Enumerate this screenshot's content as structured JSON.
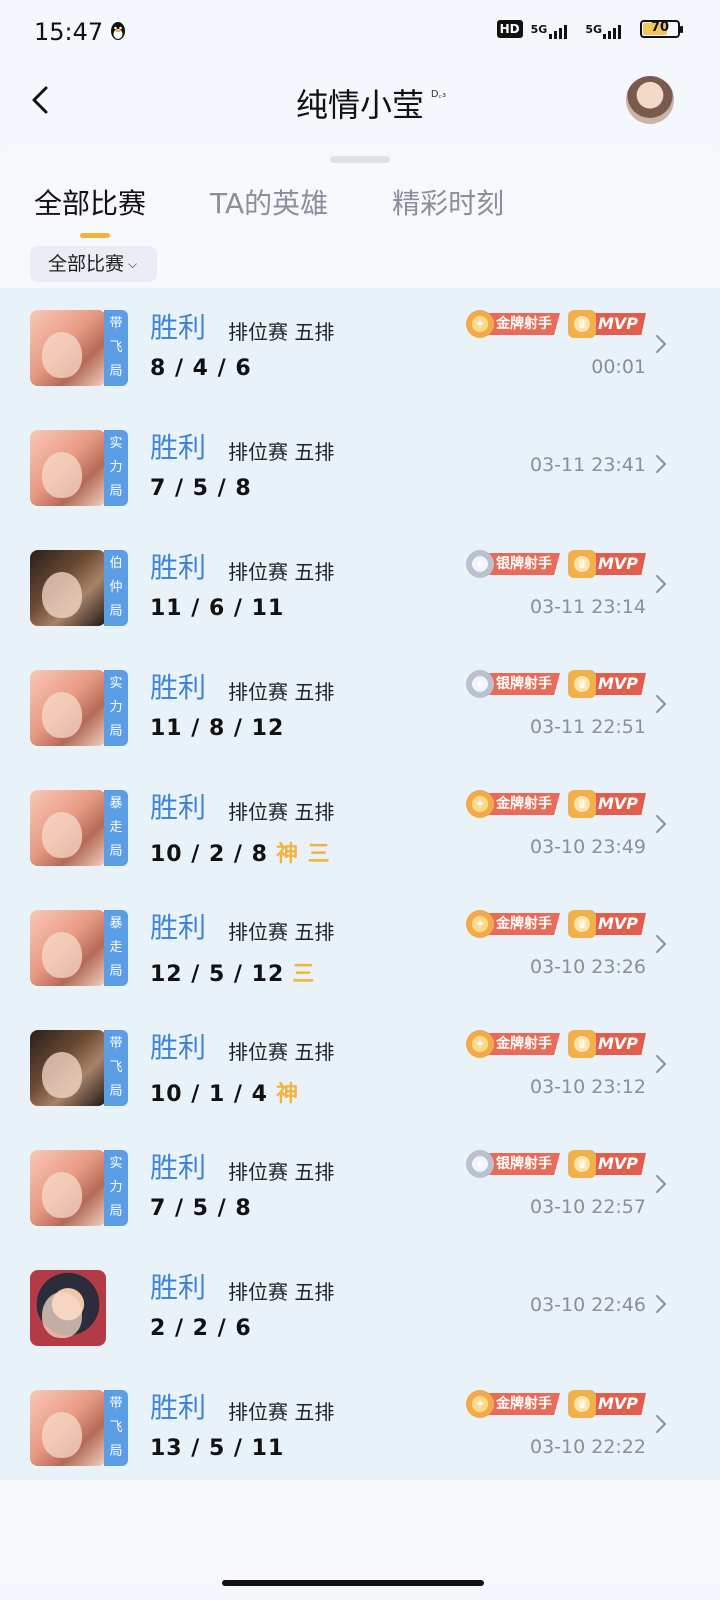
{
  "status_bar": {
    "time": "15:47",
    "hd_label": "HD",
    "net1": "5G",
    "net2": "5G",
    "battery": "70",
    "battery_level": 0.7
  },
  "header": {
    "title": "纯情小莹",
    "title_badge": "D꜀₃"
  },
  "tabs": [
    {
      "label": "全部比赛",
      "active": true
    },
    {
      "label": "TA的英雄",
      "active": false
    },
    {
      "label": "精彩时刻",
      "active": false
    }
  ],
  "filter": {
    "label": "全部比赛"
  },
  "badge_labels": {
    "gold": "金牌射手",
    "silver": "银牌射手",
    "mvp": "MVP"
  },
  "matches": [
    {
      "hero_style": "pink",
      "tag": "带飞局",
      "result": "胜利",
      "mode": "排位赛 五排",
      "kda": "8 / 4 / 6",
      "extra": "",
      "time": "00:01",
      "badge": "gold",
      "mvp": true
    },
    {
      "hero_style": "pink",
      "tag": "实力局",
      "result": "胜利",
      "mode": "排位赛 五排",
      "kda": "7 / 5 / 8",
      "extra": "",
      "time": "03-11 23:41",
      "badge": "",
      "mvp": false
    },
    {
      "hero_style": "dark",
      "tag": "伯仲局",
      "result": "胜利",
      "mode": "排位赛 五排",
      "kda": "11 / 6 / 11",
      "extra": "",
      "time": "03-11 23:14",
      "badge": "silver",
      "mvp": true
    },
    {
      "hero_style": "pink",
      "tag": "实力局",
      "result": "胜利",
      "mode": "排位赛 五排",
      "kda": "11 / 8 / 12",
      "extra": "",
      "time": "03-11 22:51",
      "badge": "silver",
      "mvp": true
    },
    {
      "hero_style": "pink",
      "tag": "暴走局",
      "result": "胜利",
      "mode": "排位赛 五排",
      "kda": "10 / 2 / 8",
      "extra": "神 三",
      "time": "03-10 23:49",
      "badge": "gold",
      "mvp": true
    },
    {
      "hero_style": "pink",
      "tag": "暴走局",
      "result": "胜利",
      "mode": "排位赛 五排",
      "kda": "12 / 5 / 12",
      "extra": "三",
      "time": "03-10 23:26",
      "badge": "gold",
      "mvp": true
    },
    {
      "hero_style": "dark",
      "tag": "带飞局",
      "result": "胜利",
      "mode": "排位赛 五排",
      "kda": "10 / 1 / 4",
      "extra": "神",
      "time": "03-10 23:12",
      "badge": "gold",
      "mvp": true
    },
    {
      "hero_style": "pink",
      "tag": "实力局",
      "result": "胜利",
      "mode": "排位赛 五排",
      "kda": "7 / 5 / 8",
      "extra": "",
      "time": "03-10 22:57",
      "badge": "silver",
      "mvp": true
    },
    {
      "hero_style": "kid",
      "tag": "",
      "result": "胜利",
      "mode": "排位赛 五排",
      "kda": "2 / 2 / 6",
      "extra": "",
      "time": "03-10 22:46",
      "badge": "",
      "mvp": false
    },
    {
      "hero_style": "pink",
      "tag": "带飞局",
      "result": "胜利",
      "mode": "排位赛 五排",
      "kda": "13 / 5 / 11",
      "extra": "",
      "time": "03-10 22:22",
      "badge": "gold",
      "mvp": true
    }
  ]
}
